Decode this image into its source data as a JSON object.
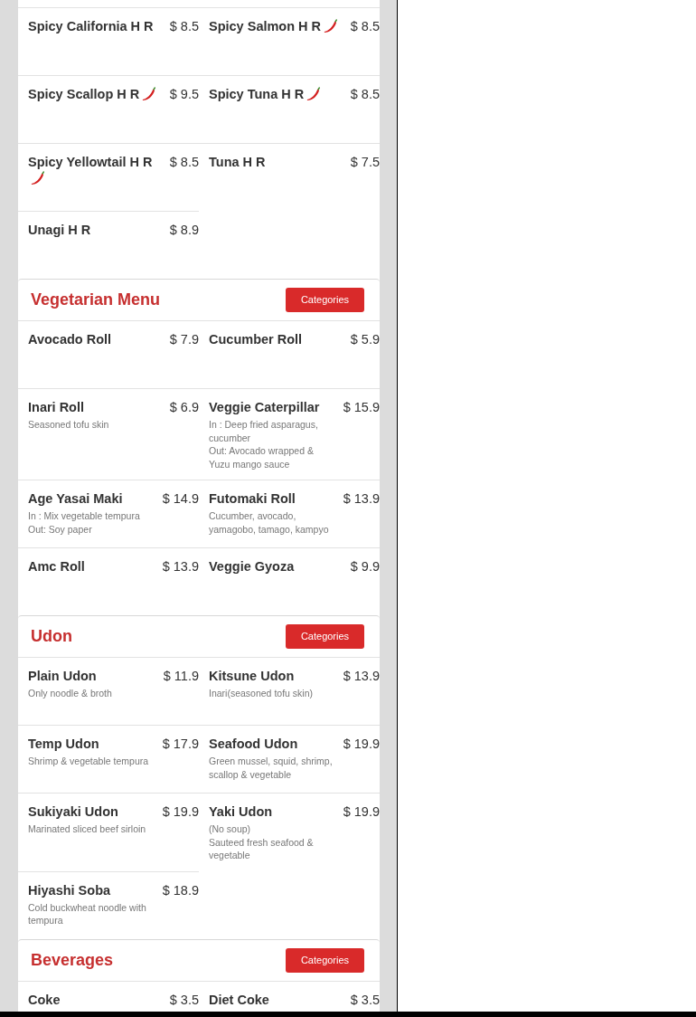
{
  "sections": [
    {
      "items": [
        {
          "name": "Spicy California H R",
          "price": "$ 8.5",
          "spicy": false
        },
        {
          "name": "Spicy Salmon H R",
          "price": "$ 8.5",
          "spicy": true
        },
        {
          "name": "Spicy Scallop H R",
          "price": "$ 9.5",
          "spicy": true
        },
        {
          "name": "Spicy Tuna H R",
          "price": "$ 8.5",
          "spicy": true
        },
        {
          "name": "Spicy Yellowtail H R",
          "price": "$ 8.5",
          "spicy": true
        },
        {
          "name": "Tuna H R",
          "price": "$ 7.5",
          "spicy": false
        },
        {
          "name": "Unagi H R",
          "price": "$ 8.9",
          "spicy": false
        }
      ]
    },
    {
      "title": "Vegetarian Menu",
      "button": "Categories",
      "items": [
        {
          "name": "Avocado Roll",
          "price": "$ 7.9",
          "spicy": false
        },
        {
          "name": "Cucumber Roll",
          "price": "$ 5.9",
          "spicy": false
        },
        {
          "name": "Inari Roll",
          "price": "$ 6.9",
          "spicy": false,
          "description": [
            "Seasoned tofu skin"
          ]
        },
        {
          "name": "Veggie Caterpillar",
          "price": "$ 15.9",
          "spicy": false,
          "description": [
            "In : Deep fried asparagus, cucumber",
            "Out: Avocado wrapped & Yuzu mango sauce"
          ]
        },
        {
          "name": "Age Yasai Maki",
          "price": "$ 14.9",
          "spicy": false,
          "description": [
            "In : Mix vegetable tempura",
            "Out: Soy paper"
          ]
        },
        {
          "name": "Futomaki Roll",
          "price": "$ 13.9",
          "spicy": false,
          "description": [
            "Cucumber, avocado, yamagobo, tamago, kampyo"
          ]
        },
        {
          "name": "Amc Roll",
          "price": "$ 13.9",
          "spicy": false
        },
        {
          "name": "Veggie Gyoza",
          "price": "$ 9.9",
          "spicy": false
        }
      ]
    },
    {
      "title": "Udon",
      "button": "Categories",
      "items": [
        {
          "name": "Plain Udon",
          "price": "$ 11.9",
          "spicy": false,
          "description": [
            "Only noodle & broth"
          ]
        },
        {
          "name": "Kitsune Udon",
          "price": "$ 13.9",
          "spicy": false,
          "description": [
            "Inari(seasoned tofu skin)"
          ]
        },
        {
          "name": "Temp Udon",
          "price": "$ 17.9",
          "spicy": false,
          "description": [
            "Shrimp & vegetable tempura"
          ]
        },
        {
          "name": "Seafood Udon",
          "price": "$ 19.9",
          "spicy": false,
          "description": [
            "Green mussel, squid, shrimp, scallop & vegetable"
          ]
        },
        {
          "name": "Sukiyaki Udon",
          "price": "$ 19.9",
          "spicy": false,
          "description": [
            "Marinated sliced beef sirloin"
          ]
        },
        {
          "name": "Yaki Udon",
          "price": "$ 19.9",
          "spicy": false,
          "description": [
            "(No soup)",
            "Sauteed fresh seafood & vegetable"
          ]
        },
        {
          "name": "Hiyashi Soba",
          "price": "$ 18.9",
          "spicy": false,
          "description": [
            "Cold buckwheat noodle with tempura"
          ]
        }
      ]
    },
    {
      "title": "Beverages",
      "button": "Categories",
      "items": [
        {
          "name": "Coke",
          "price": "$ 3.5",
          "spicy": false
        },
        {
          "name": "Diet Coke",
          "price": "$ 3.5",
          "spicy": false
        }
      ]
    }
  ]
}
